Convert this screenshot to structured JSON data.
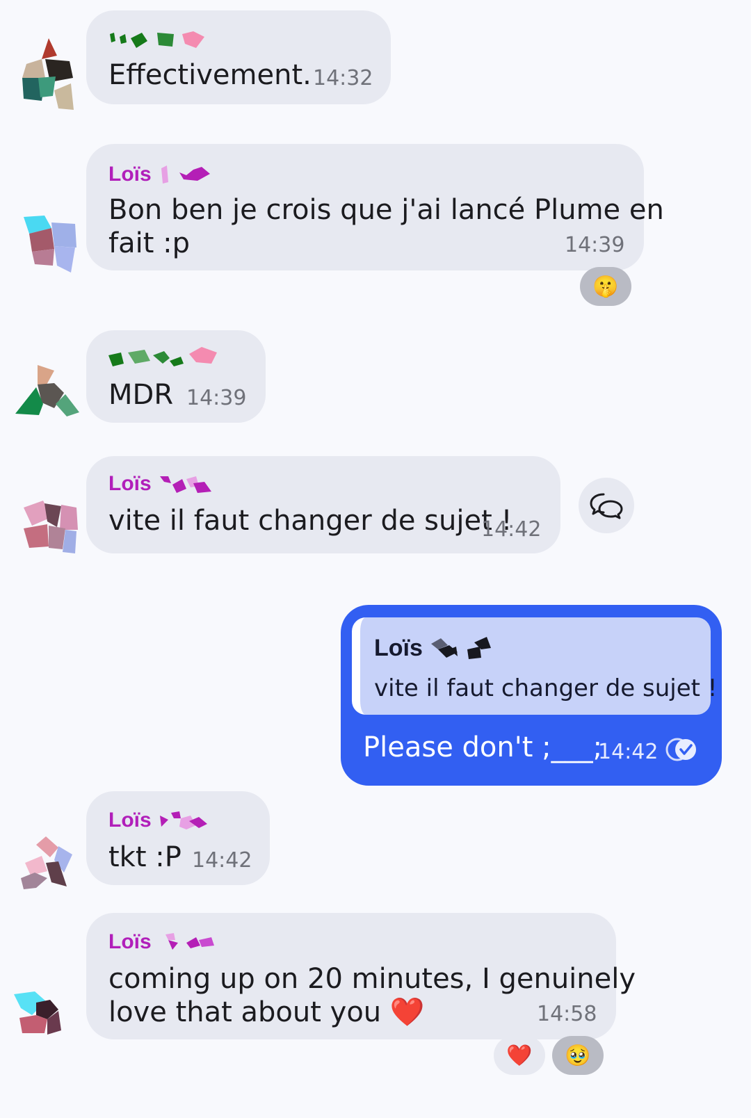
{
  "messages": [
    {
      "sender": "",
      "text": "Effectivement.",
      "time": "14:32"
    },
    {
      "sender": "Loïs",
      "text_line1": "Bon ben je crois que j'ai lancé Plume en",
      "text_line2": "fait :p",
      "time": "14:39",
      "reactions": [
        {
          "emoji": "🤫"
        }
      ]
    },
    {
      "sender": "",
      "text": "MDR",
      "time": "14:39"
    },
    {
      "sender": "Loïs",
      "text": "vite il faut changer de sujet !",
      "time": "14:42"
    },
    {
      "sender": "Loïs",
      "text": "tkt :P",
      "time": "14:42"
    },
    {
      "sender": "Loïs",
      "text_line1": "coming up on 20 minutes, I genuinely",
      "text_line2": "love that about you ❤️",
      "time": "14:58",
      "reactions": [
        {
          "emoji": "❤️"
        },
        {
          "emoji": "🥹"
        }
      ]
    }
  ],
  "own_message": {
    "quote_sender": "Loïs",
    "quote_text": "vite il faut changer de sujet !",
    "text": "Please don't ;___;",
    "time": "14:42",
    "status_icon": "read-receipt-icon"
  },
  "thread_icon": "thread-reply-icon",
  "colors": {
    "background": "#f8f9fd",
    "bubble": "#e7e9f1",
    "own_bubble": "#325ff2",
    "quote": "#c7d2f9",
    "sender": "#b11fba",
    "time": "#6f7179"
  }
}
